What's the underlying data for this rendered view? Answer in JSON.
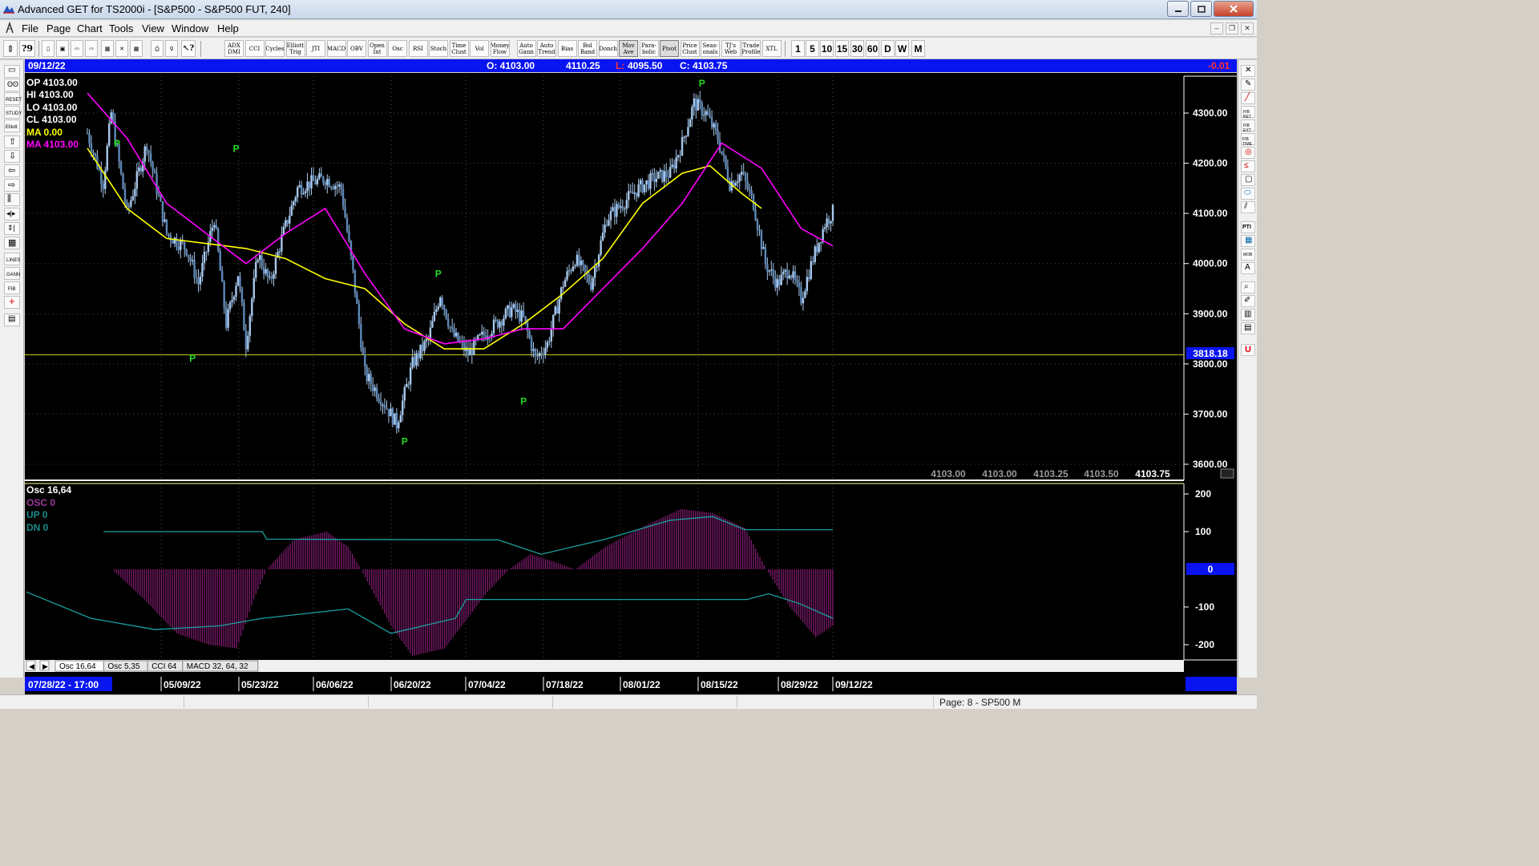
{
  "window": {
    "title": "Advanced GET for TS2000i - [S&P500 - S&P500 FUT, 240]"
  },
  "menu": {
    "items": [
      "File",
      "Page",
      "Chart",
      "Tools",
      "View",
      "Window",
      "Help"
    ]
  },
  "toolbar": {
    "indicator_buttons": [
      {
        "label": "ADX DMI",
        "selected": false
      },
      {
        "label": "CCI",
        "selected": false
      },
      {
        "label": "Cycles",
        "selected": false
      },
      {
        "label": "Elliott Trig",
        "selected": false
      },
      {
        "label": "JTI",
        "selected": false
      },
      {
        "label": "MACD",
        "selected": false
      },
      {
        "label": "OBV",
        "selected": false
      },
      {
        "label": "Open Int",
        "selected": false
      },
      {
        "label": "Osc",
        "selected": false
      },
      {
        "label": "RSI",
        "selected": false
      },
      {
        "label": "Stoch",
        "selected": false
      },
      {
        "label": "Time Clust",
        "selected": false
      },
      {
        "label": "Vol",
        "selected": false
      },
      {
        "label": "Money Flow",
        "selected": false
      },
      {
        "label": "Auto Gann",
        "selected": false
      },
      {
        "label": "Auto Trend",
        "selected": false
      },
      {
        "label": "Bias",
        "selected": false
      },
      {
        "label": "Bol Band",
        "selected": false
      },
      {
        "label": "Donch",
        "selected": false
      },
      {
        "label": "Mov Ave",
        "selected": true
      },
      {
        "label": "Para- bolic",
        "selected": false
      },
      {
        "label": "Pivot",
        "selected": true
      },
      {
        "label": "Price Clust",
        "selected": false
      },
      {
        "label": "Seas- onals",
        "selected": false
      },
      {
        "label": "TJ's Web",
        "selected": false
      },
      {
        "label": "Trade Profile",
        "selected": false
      },
      {
        "label": "XTL",
        "selected": false
      }
    ],
    "interval_buttons": [
      "1",
      "5",
      "10",
      "15",
      "30",
      "60",
      "D",
      "W",
      "M"
    ]
  },
  "infobar": {
    "date": "09/12/22",
    "open": "O: 4103.00",
    "high": "4110.25",
    "low_label": "L:",
    "low": "4095.50",
    "close": "C: 4103.75",
    "change": "-0.01"
  },
  "price_panel": {
    "legend": {
      "op": "OP  4103.00",
      "hi": "HI   4103.00",
      "lo": "LO  4103.00",
      "cl": "CL  4103.00",
      "ma1": "MA  0.00",
      "ma2": "MA  4103.00"
    },
    "pivot_label": "P",
    "horizontal_line_value": "3818.18",
    "bottom_quotes": [
      "4103.00",
      "4103.00",
      "4103.25",
      "4103.50",
      "4103.75"
    ]
  },
  "osc_panel": {
    "title": "Osc 16,64",
    "legend": {
      "osc": "OSC 0",
      "up": "UP   0",
      "dn": "DN   0"
    },
    "zero_label": "0"
  },
  "tabs": [
    "Osc 16,64",
    "Osc 5,35",
    "CCI 64",
    "MACD 32, 64, 32"
  ],
  "time_axis": {
    "cursor_time": "07/28/22 - 17:00"
  },
  "status": {
    "page": "Page: 8 - SP500 M"
  },
  "chart_data": [
    {
      "type": "candlestick",
      "title": "S&P500 - S&P500 FUT, 240",
      "x_tick_labels": [
        "05/09/22",
        "05/23/22",
        "06/06/22",
        "06/20/22",
        "07/04/22",
        "07/18/22",
        "08/01/22",
        "08/15/22",
        "08/29/22",
        "09/12/22"
      ],
      "y_tick_labels": [
        "3600.00",
        "3700.00",
        "3800.00",
        "3900.00",
        "4000.00",
        "4100.00",
        "4200.00",
        "4300.00"
      ],
      "ylim": [
        3560,
        4380
      ],
      "close_path": [
        {
          "bar": 0,
          "close": 4260
        },
        {
          "bar": 8,
          "close": 4160
        },
        {
          "bar": 12,
          "close": 4300
        },
        {
          "bar": 20,
          "close": 4100
        },
        {
          "bar": 30,
          "close": 4240
        },
        {
          "bar": 40,
          "close": 4060
        },
        {
          "bar": 50,
          "close": 4030
        },
        {
          "bar": 56,
          "close": 3960
        },
        {
          "bar": 64,
          "close": 4090
        },
        {
          "bar": 70,
          "close": 3880
        },
        {
          "bar": 76,
          "close": 3980
        },
        {
          "bar": 80,
          "close": 3840
        },
        {
          "bar": 86,
          "close": 4020
        },
        {
          "bar": 92,
          "close": 3960
        },
        {
          "bar": 98,
          "close": 4050
        },
        {
          "bar": 106,
          "close": 4150
        },
        {
          "bar": 112,
          "close": 4160
        },
        {
          "bar": 120,
          "close": 4170
        },
        {
          "bar": 128,
          "close": 4150
        },
        {
          "bar": 134,
          "close": 3980
        },
        {
          "bar": 140,
          "close": 3780
        },
        {
          "bar": 150,
          "close": 3720
        },
        {
          "bar": 156,
          "close": 3680
        },
        {
          "bar": 164,
          "close": 3800
        },
        {
          "bar": 172,
          "close": 3850
        },
        {
          "bar": 178,
          "close": 3940
        },
        {
          "bar": 184,
          "close": 3860
        },
        {
          "bar": 192,
          "close": 3820
        },
        {
          "bar": 198,
          "close": 3850
        },
        {
          "bar": 206,
          "close": 3880
        },
        {
          "bar": 214,
          "close": 3910
        },
        {
          "bar": 220,
          "close": 3890
        },
        {
          "bar": 226,
          "close": 3810
        },
        {
          "bar": 232,
          "close": 3840
        },
        {
          "bar": 240,
          "close": 3960
        },
        {
          "bar": 246,
          "close": 4010
        },
        {
          "bar": 254,
          "close": 3960
        },
        {
          "bar": 262,
          "close": 4090
        },
        {
          "bar": 270,
          "close": 4120
        },
        {
          "bar": 278,
          "close": 4150
        },
        {
          "bar": 286,
          "close": 4170
        },
        {
          "bar": 294,
          "close": 4180
        },
        {
          "bar": 300,
          "close": 4240
        },
        {
          "bar": 306,
          "close": 4320
        },
        {
          "bar": 312,
          "close": 4300
        },
        {
          "bar": 318,
          "close": 4250
        },
        {
          "bar": 324,
          "close": 4160
        },
        {
          "bar": 330,
          "close": 4180
        },
        {
          "bar": 336,
          "close": 4120
        },
        {
          "bar": 342,
          "close": 4000
        },
        {
          "bar": 348,
          "close": 3960
        },
        {
          "bar": 354,
          "close": 3990
        },
        {
          "bar": 360,
          "close": 3930
        },
        {
          "bar": 366,
          "close": 4010
        },
        {
          "bar": 372,
          "close": 4080
        },
        {
          "bar": 376,
          "close": 4103
        }
      ],
      "series": [
        {
          "name": "MA 0.00",
          "color": "#ffff00",
          "points": [
            {
              "bar": 0,
              "v": 4230
            },
            {
              "bar": 20,
              "v": 4110
            },
            {
              "bar": 40,
              "v": 4050
            },
            {
              "bar": 60,
              "v": 4040
            },
            {
              "bar": 80,
              "v": 4030
            },
            {
              "bar": 100,
              "v": 4010
            },
            {
              "bar": 120,
              "v": 3970
            },
            {
              "bar": 140,
              "v": 3950
            },
            {
              "bar": 160,
              "v": 3880
            },
            {
              "bar": 180,
              "v": 3830
            },
            {
              "bar": 200,
              "v": 3830
            },
            {
              "bar": 220,
              "v": 3880
            },
            {
              "bar": 240,
              "v": 3940
            },
            {
              "bar": 260,
              "v": 4010
            },
            {
              "bar": 280,
              "v": 4120
            },
            {
              "bar": 300,
              "v": 4180
            },
            {
              "bar": 314,
              "v": 4195
            },
            {
              "bar": 330,
              "v": 4140
            },
            {
              "bar": 340,
              "v": 4110
            }
          ]
        },
        {
          "name": "MA 4103.00",
          "color": "#ff00ff",
          "points": [
            {
              "bar": 0,
              "v": 4340
            },
            {
              "bar": 20,
              "v": 4250
            },
            {
              "bar": 40,
              "v": 4120
            },
            {
              "bar": 60,
              "v": 4060
            },
            {
              "bar": 80,
              "v": 4000
            },
            {
              "bar": 100,
              "v": 4060
            },
            {
              "bar": 120,
              "v": 4110
            },
            {
              "bar": 140,
              "v": 3980
            },
            {
              "bar": 160,
              "v": 3870
            },
            {
              "bar": 180,
              "v": 3840
            },
            {
              "bar": 200,
              "v": 3850
            },
            {
              "bar": 220,
              "v": 3870
            },
            {
              "bar": 240,
              "v": 3870
            },
            {
              "bar": 260,
              "v": 3950
            },
            {
              "bar": 280,
              "v": 4030
            },
            {
              "bar": 300,
              "v": 4120
            },
            {
              "bar": 320,
              "v": 4240
            },
            {
              "bar": 340,
              "v": 4190
            },
            {
              "bar": 360,
              "v": 4070
            },
            {
              "bar": 376,
              "v": 4035
            }
          ]
        }
      ],
      "pivots": [
        {
          "bar": 15,
          "type": "high",
          "price": 4220
        },
        {
          "bar": 53,
          "type": "low",
          "price": 3830
        },
        {
          "bar": 75,
          "type": "high",
          "price": 4210
        },
        {
          "bar": 160,
          "type": "low",
          "price": 3665
        },
        {
          "bar": 177,
          "type": "high",
          "price": 3960
        },
        {
          "bar": 220,
          "type": "low",
          "price": 3745
        },
        {
          "bar": 310,
          "type": "high",
          "price": 4340
        }
      ],
      "horizontal_line": 3818.18,
      "total_bars": 377
    },
    {
      "type": "bar",
      "title": "Osc 16,64",
      "y_tick_labels": [
        "-200",
        "-100",
        "0",
        "100",
        "200"
      ],
      "ylim": [
        -240,
        230
      ],
      "osc_path": [
        {
          "bar": 0,
          "v": 0
        },
        {
          "bar": 40,
          "v": 0
        },
        {
          "bar": 55,
          "v": -80
        },
        {
          "bar": 70,
          "v": -170
        },
        {
          "bar": 85,
          "v": -200
        },
        {
          "bar": 98,
          "v": -210
        },
        {
          "bar": 106,
          "v": -80
        },
        {
          "bar": 112,
          "v": 0
        },
        {
          "bar": 125,
          "v": 80
        },
        {
          "bar": 140,
          "v": 100
        },
        {
          "bar": 150,
          "v": 60
        },
        {
          "bar": 156,
          "v": 0
        },
        {
          "bar": 170,
          "v": -150
        },
        {
          "bar": 180,
          "v": -230
        },
        {
          "bar": 195,
          "v": -210
        },
        {
          "bar": 215,
          "v": -60
        },
        {
          "bar": 225,
          "v": 0
        },
        {
          "bar": 235,
          "v": 40
        },
        {
          "bar": 246,
          "v": 20
        },
        {
          "bar": 256,
          "v": 0
        },
        {
          "bar": 270,
          "v": 60
        },
        {
          "bar": 290,
          "v": 120
        },
        {
          "bar": 305,
          "v": 160
        },
        {
          "bar": 320,
          "v": 150
        },
        {
          "bar": 335,
          "v": 110
        },
        {
          "bar": 345,
          "v": 0
        },
        {
          "bar": 356,
          "v": -100
        },
        {
          "bar": 368,
          "v": -180
        },
        {
          "bar": 376,
          "v": -150
        }
      ],
      "up_band": [
        {
          "bar": 36,
          "v": 100
        },
        {
          "bar": 110,
          "v": 100
        },
        {
          "bar": 112,
          "v": 80
        },
        {
          "bar": 220,
          "v": 78
        },
        {
          "bar": 240,
          "v": 40
        },
        {
          "bar": 270,
          "v": 80
        },
        {
          "bar": 300,
          "v": 130
        },
        {
          "bar": 320,
          "v": 140
        },
        {
          "bar": 335,
          "v": 105
        },
        {
          "bar": 376,
          "v": 105
        }
      ],
      "dn_band": [
        {
          "bar": 0,
          "v": -60
        },
        {
          "bar": 30,
          "v": -130
        },
        {
          "bar": 60,
          "v": -160
        },
        {
          "bar": 90,
          "v": -150
        },
        {
          "bar": 110,
          "v": -130
        },
        {
          "bar": 150,
          "v": -105
        },
        {
          "bar": 170,
          "v": -170
        },
        {
          "bar": 200,
          "v": -130
        },
        {
          "bar": 205,
          "v": -80
        },
        {
          "bar": 336,
          "v": -80
        },
        {
          "bar": 346,
          "v": -65
        },
        {
          "bar": 360,
          "v": -90
        },
        {
          "bar": 376,
          "v": -130
        }
      ]
    }
  ]
}
